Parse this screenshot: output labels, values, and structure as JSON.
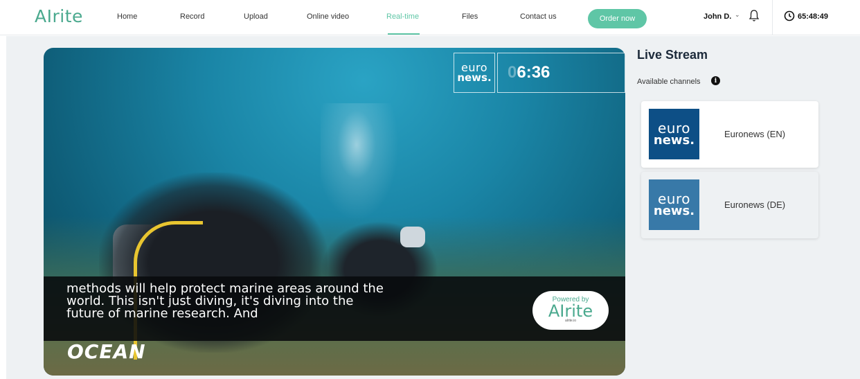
{
  "app": {
    "logo": "AIrite"
  },
  "nav": {
    "items": [
      {
        "label": "Home"
      },
      {
        "label": "Record"
      },
      {
        "label": "Upload"
      },
      {
        "label": "Online video"
      },
      {
        "label": "Real-time"
      },
      {
        "label": "Files"
      },
      {
        "label": "Contact us"
      }
    ],
    "active": "Real-time",
    "order_button": "Order now",
    "user_name": "John D.",
    "timer": "65:48:49",
    "accent_color": "#5fc6a6"
  },
  "video": {
    "channel_brand_line1": "euro",
    "channel_brand_line2": "news.",
    "clock_dim_digit": "0",
    "clock_time": "6:36",
    "caption": "methods will help protect marine areas around the world. This isn't just diving, it's diving into the future of marine research. And",
    "lower_text": "OCEAN",
    "powered_by": "Powered by",
    "powered_logo": "AIrite",
    "powered_url": "alrite.io"
  },
  "sidebar": {
    "title": "Live Stream",
    "channels_label": "Available channels",
    "channels": [
      {
        "thumb_line1": "euro",
        "thumb_line2": "news.",
        "name": "Euronews (EN)",
        "selected": true
      },
      {
        "thumb_line1": "euro",
        "thumb_line2": "news.",
        "name": "Euronews (DE)",
        "selected": false
      }
    ]
  }
}
